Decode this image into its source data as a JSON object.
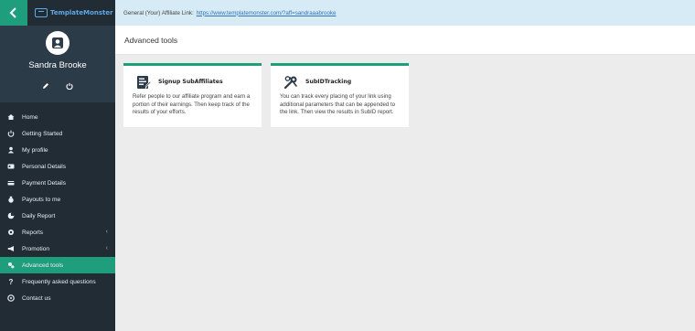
{
  "brand": {
    "logo_text": "TemplateMonster",
    "accent": "#1f9e7d"
  },
  "topbar": {
    "affiliate_label": "General (Your) Affiliate Link:",
    "affiliate_link": "https://www.templatemonster.com/?aff=sandraaabrooke"
  },
  "profile": {
    "name": "Sandra Brooke"
  },
  "menu": [
    {
      "label": "Home",
      "icon": "home-icon"
    },
    {
      "label": "Getting Started",
      "icon": "power-icon"
    },
    {
      "label": "My profile",
      "icon": "user-icon"
    },
    {
      "label": "Personal Details",
      "icon": "id-card-icon"
    },
    {
      "label": "Payment Details",
      "icon": "card-icon"
    },
    {
      "label": "Payouts to me",
      "icon": "money-bag-icon"
    },
    {
      "label": "Daily Report",
      "icon": "chart-icon"
    },
    {
      "label": "Reports",
      "icon": "reports-icon",
      "has_submenu": true
    },
    {
      "label": "Promotion",
      "icon": "megaphone-icon",
      "has_submenu": true
    },
    {
      "label": "Advanced tools",
      "icon": "tools-icon",
      "active": true
    },
    {
      "label": "Frequently asked questions",
      "icon": "question-icon"
    },
    {
      "label": "Contact us",
      "icon": "contact-icon"
    }
  ],
  "page": {
    "title": "Advanced tools"
  },
  "cards": [
    {
      "title": "Signup SubAffiliates",
      "icon": "signup-form-icon",
      "text": "Refer people to our affiliate program and earn a portion of their earnings. Then keep track of the results of your efforts."
    },
    {
      "title": "SubIDTracking",
      "icon": "tracking-tools-icon",
      "text": "You can track every placing of your link using additional parameters that can be appended to the link. Then view the results in SubID report."
    }
  ]
}
